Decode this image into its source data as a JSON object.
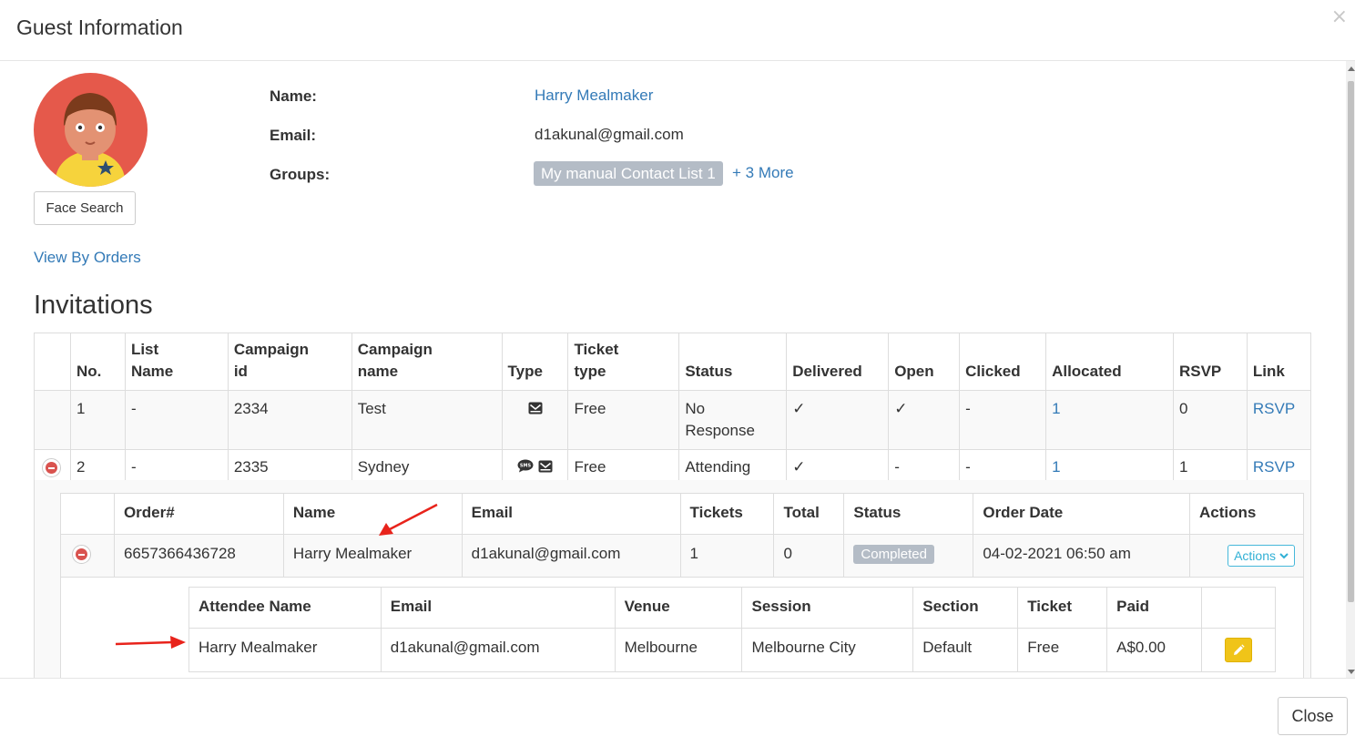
{
  "modal": {
    "title": "Guest Information",
    "close_x": "×",
    "close_button": "Close"
  },
  "guest": {
    "face_search": "Face Search",
    "name_label": "Name:",
    "name_value": "Harry Mealmaker",
    "email_label": "Email:",
    "email_value": "d1akunal@gmail.com",
    "groups_label": "Groups:",
    "group_badge": "My manual Contact List 1",
    "more_link": "+ 3 More",
    "view_orders": "View By Orders"
  },
  "invitations": {
    "title": "Invitations",
    "headers": {
      "no": "No.",
      "list_name_1": "List",
      "list_name_2": "Name",
      "campaign_id_1": "Campaign",
      "campaign_id_2": "id",
      "campaign_name_1": "Campaign",
      "campaign_name_2": "name",
      "type": "Type",
      "ticket_type_1": "Ticket",
      "ticket_type_2": "type",
      "status": "Status",
      "delivered": "Delivered",
      "open": "Open",
      "clicked": "Clicked",
      "allocated": "Allocated",
      "rsvp": "RSVP",
      "link": "Link"
    },
    "rows": [
      {
        "no": "1",
        "list_name": "-",
        "campaign_id": "2334",
        "campaign_name": "Test",
        "type_icons": [
          "envelope-icon"
        ],
        "ticket_type": "Free",
        "status_1": "No",
        "status_2": "Response",
        "delivered": "✓",
        "open": "✓",
        "clicked": "-",
        "allocated": "1",
        "rsvp": "0",
        "link": "RSVP"
      },
      {
        "no": "2",
        "list_name": "-",
        "campaign_id": "2335",
        "campaign_name": "Sydney",
        "type_icons": [
          "sms-icon",
          "envelope-icon"
        ],
        "ticket_type": "Free",
        "status": "Attending",
        "delivered": "✓",
        "open": "-",
        "clicked": "-",
        "allocated": "1",
        "rsvp": "1",
        "link": "RSVP"
      }
    ]
  },
  "orders": {
    "headers": {
      "order_no": "Order#",
      "name": "Name",
      "email": "Email",
      "tickets": "Tickets",
      "total": "Total",
      "status": "Status",
      "order_date": "Order Date",
      "actions": "Actions"
    },
    "row": {
      "order_no": "6657366436728",
      "name": "Harry Mealmaker",
      "email": "d1akunal@gmail.com",
      "tickets": "1",
      "total": "0",
      "status": "Completed",
      "order_date": "04-02-2021 06:50 am",
      "actions": "Actions"
    }
  },
  "attendees": {
    "headers": {
      "name": "Attendee Name",
      "email": "Email",
      "venue": "Venue",
      "session": "Session",
      "section": "Section",
      "ticket": "Ticket",
      "paid": "Paid"
    },
    "row": {
      "name": "Harry Mealmaker",
      "email": "d1akunal@gmail.com",
      "venue": "Melbourne",
      "session": "Melbourne City",
      "section": "Default",
      "ticket": "Free",
      "paid": "A$0.00"
    }
  },
  "colors": {
    "link": "#337ab7",
    "badge": "#b4bcc6",
    "danger": "#d9534f",
    "info": "#31b0d5",
    "warning": "#f0c419",
    "arrow": "#e8231b"
  }
}
